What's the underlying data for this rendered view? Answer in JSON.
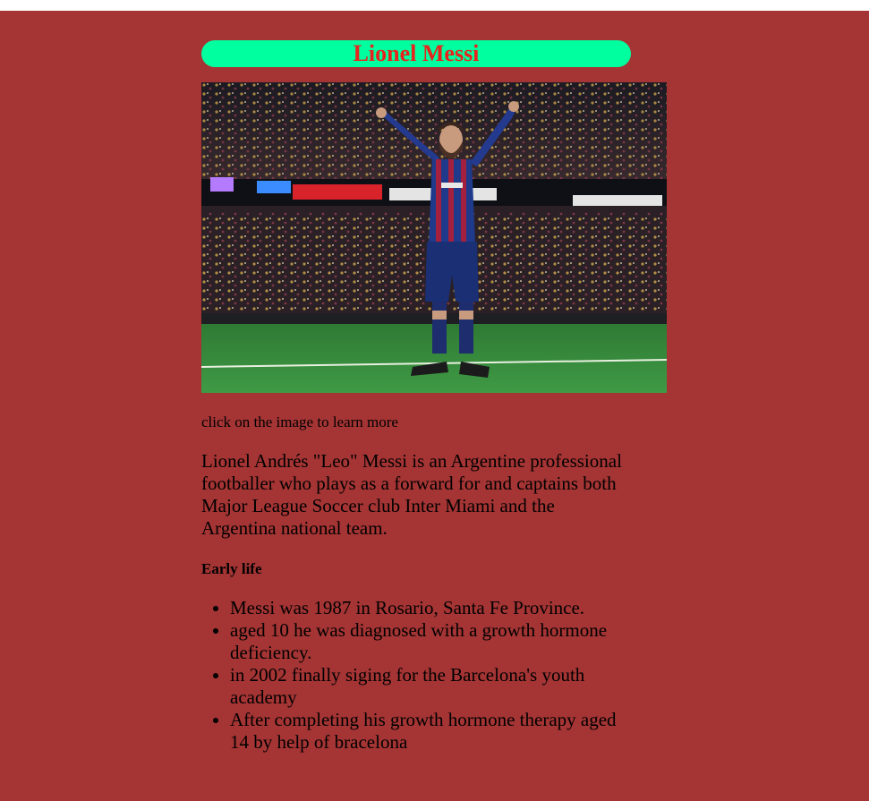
{
  "header": {
    "title": "Lionel Messi"
  },
  "hero_image": {
    "alt": "Lionel Messi celebrating in the stadium",
    "link_hint": "click on the image to learn more"
  },
  "article": {
    "intro": "Lionel Andrés \"Leo\" Messi is an Argentine professional footballer who plays as a forward for and captains both Major League Soccer club Inter Miami and the Argentina national team.",
    "section_title": "Early life",
    "facts": [
      "Messi was 1987 in Rosario, Santa Fe Province.",
      "aged 10 he was diagnosed with a growth hormone deficiency.",
      "in 2002 finally siging for the Barcelona's youth academy",
      "After completing his growth hormone therapy aged 14 by help of bracelona"
    ]
  },
  "colors": {
    "page_background": "#a53434",
    "title_pill": "#00ff9f",
    "title_text": "#e8231d"
  }
}
